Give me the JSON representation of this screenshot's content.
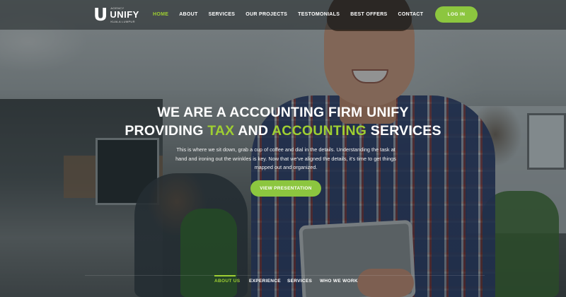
{
  "brand": {
    "logo_letter": "U",
    "agency_tag": "AGENCY",
    "name": "UNIFY",
    "city": "KUALA LUMPUR"
  },
  "nav": {
    "items": [
      {
        "label": "HOME",
        "active": true
      },
      {
        "label": "ABOUT",
        "active": false
      },
      {
        "label": "SERVICES",
        "active": false
      },
      {
        "label": "OUR PROJECTS",
        "active": false
      },
      {
        "label": "TESTOMONIALS",
        "active": false
      },
      {
        "label": "BEST OFFERS",
        "active": false
      },
      {
        "label": "CONTACT",
        "active": false
      }
    ],
    "login_label": "LOG IN"
  },
  "hero": {
    "line1": "WE ARE A ACCOUNTING FIRM UNIFY",
    "line2_prefix": "PROVIDING ",
    "line2_accent1": "TAX",
    "line2_mid": " AND ",
    "line2_accent2": "ACCOUNTING",
    "line2_suffix": " SERVICES",
    "description": "This is where we sit down, grab a cup of coffee and dial in the details. Understanding the task at hand and ironing out the wrinkles is key. Now that we've aligned the details, it's time to get things mapped out and organized.",
    "cta_label": "VIEW PRESENTATION"
  },
  "bottom_tabs": [
    {
      "label": "ABOUT US",
      "active": true
    },
    {
      "label": "EXPERIENCE",
      "active": false
    },
    {
      "label": "SERVICES",
      "active": false
    },
    {
      "label": "WHO WE WORK",
      "active": false
    }
  ],
  "colors": {
    "accent": "#8cc63f",
    "accent_text": "#9fcf32"
  }
}
